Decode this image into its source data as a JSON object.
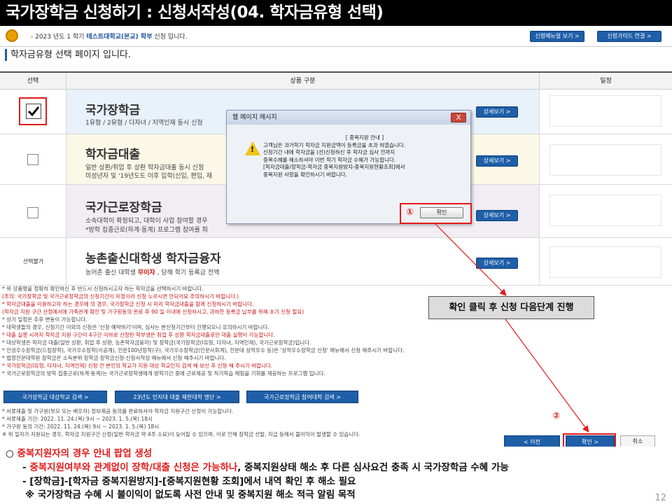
{
  "title": "국가장학금 신청하기 : 신청서작성(04. 학자금유형 선택)",
  "infobar": {
    "prefix": "- 2023 년도 1 학기",
    "school": "테스트대학교(본교) 학부",
    "suffix": "신청 입니다.",
    "btn_menu": "신청메뉴얼 보기 >",
    "btn_guide": "신청가이드 연결 >"
  },
  "section_title": "학자금유형 선택 페이지 입니다.",
  "table": {
    "col_select": "선택",
    "col_product": "상품 구분",
    "col_schedule": "일정",
    "detail_btn": "상세보기 >",
    "rows": [
      {
        "name": "국가장학금",
        "desc1": "1유형 / 2유형 / 다자녀 / 지역인재 동시 신청",
        "desc2": "",
        "checked": true,
        "bg": "#e9f1fa"
      },
      {
        "name": "학자금대출",
        "desc1": "일반 상환/취업 후 상환 학자금대출 동시 신청",
        "desc2": "미성년자 및 '19년도도 이후 입학(신입, 편입, 재",
        "checked": false,
        "bg": "#fbf8e8"
      },
      {
        "name": "국가근로장학금",
        "desc1": "소속대학이 확정되고, 대학이 사업 참여할 경우",
        "desc2": "*방학 집중근로(하계·동계) 프로그램 참여를 희",
        "checked": false,
        "bg": "#f1edf3"
      },
      {
        "name": "농촌출신대학생 학자금융자",
        "desc1": "농어촌 출신 대학생",
        "desc1_red": "무이자",
        "desc1_tail": ", 당해 학기 등록금 전액",
        "checked": false,
        "bg": "#ffffff",
        "disabled_label": "선택불가"
      }
    ]
  },
  "notes": [
    {
      "text": "* 위 상품명을 정확히 확인하신 후 반드시 신청하시고자 하는 학자금을 선택하시기 바랍니다.",
      "red": false
    },
    {
      "text": "(주의: 국가장학금 및 국가근로장학금의 신청기간이 미정이라 신청 누르시면 안되어요 주의하시기 바랍니다.)",
      "red": true
    },
    {
      "text": "* 학자금대출을 이용하고자 하는 경우에 의 경우, 국가장학금 신청 시 미리 학자금대출을 함께 신청하시기 바랍니다.",
      "red": true
    },
    {
      "text": "(학자금 지원 구간 산정에서에 가족관계 확인 및 가구원동의 완료 후 90 일 이내에 신청하시고, 과하한 등록금 납부를 위해 초기 신청 필요)",
      "red": true
    },
    {
      "text": "* 상기 일정은 추후 변동이 가능합니다.",
      "red": false
    },
    {
      "text": "* 대학생들의 경우, 신청기간 이외의 신청은 '신청 예약하기'이며, 심사는 본신청기간부터 진행되오니 유의하시기 바랍니다.",
      "red": false
    },
    {
      "text": "* 대출 실행 시까지 학자금 지원 구간이 4구간 이하로 산정된 학부생은 취업 후 상환 학자금대출로만 대출 실행이 가능합니다.",
      "red": true
    },
    {
      "text": "* 대상학생은 학자금 대출(일반 상환, 취업 후 상환, 농촌학자금융자) 및 장학금(국가장학금(I유형, 다자녀, 지역인재), 국가근로장학금)입니다.",
      "red": false
    },
    {
      "text": "* 인성우수장학금(드림장학), 국가우수장학(이공계), 인문100년장학(구), 국가우수장학금(인문사회계), 전문대 성적우수 등)은 '성적우수장학금 신청' 메뉴에서 신청 해주시기 바랍니다.",
      "red": false
    },
    {
      "text": "* 법정전문대학원 장학금은 소득분위·장학금·장학금신청·신청서작성 메뉴에서 신청 해주시기 바랍니다.",
      "red": false
    },
    {
      "text": "* 국가장학금(I유형, 다자녀, 지역인재) 신청 전 본인의 학교가 지원 대상 학교인지 검색 해 보신 후 신청 해 주시기 바랍니다.",
      "red": true
    },
    {
      "text": "* 국가근로장학금의 방학 집중근로(하계·동계)는 국가근로장학생에게 방학기간 중에 근로제공 및 직기학습 체험을 기회를 제공하는 프로그램 입니다.",
      "red": false
    }
  ],
  "nav_buttons": [
    "국가장학금 대상학교 검색 >",
    "23년도 인지대 대출 제한대학 명단 >",
    "국가근로장학금 참여대학 검색 >"
  ],
  "notes2": [
    "* 서류제출 및 가구원(부모 또는 배우자) 정보제공 동의를 완료하셔야 학자금 지원구간 산정이 가능합니다.",
    "* 서류제출 기간: 2022. 11. 24.(목) 9시 ~ 2023. 1. 5.(목) 18시",
    "* 가구원 동의 기간: 2022. 11. 24.(목) 9시 ~ 2023. 1. 5.(목) 18시",
    "※ 위 일자가 지원되는 경우, 학자금 지원구간 산정(일반 학자금 약 4주 소요)이 늦어질 수 있으며, 이로 인해 장학금 선발, 지급 등에서 불이익이 발생할 수 있습니다."
  ],
  "footer_buttons": {
    "prev": "< 이전",
    "next": "확인 >",
    "cancel": "취소"
  },
  "dialog": {
    "title": "웹 페이지 메시지",
    "close": "X",
    "lines": [
      "[ 중복지원 안내 ]",
      "고객님은 과거학기 학자금 지원금액이 등록금을 초과 하였습니다.",
      "신청기간 내에 학자금을 (선)신청하신 후 학자금 심사 전까지",
      "중복수혜를 해소하셔야 이번 학기 학자금 수혜가 가능합니다.",
      "[학자금대출/장학금-학자금 중복지원방지-중복지원현황조회]에서",
      "중복지원 사항을 확인하시기 바랍니다."
    ],
    "ok": "확인"
  },
  "markers": {
    "one": "①",
    "two": "②"
  },
  "callout": "확인 클릭 후 신청 다음단계 진행",
  "bottom": {
    "line1_prefix": "○ ",
    "line1": "중복지원자의 경우 안내 팝업 생성",
    "line2_dash": "- ",
    "line2_red": "중복지원여부와 관계없이 장학/대출 신청은 가능하나",
    "line2_tail": ", 중복지원상태 해소 후 다른 심사요건 충족 시 국가장학금 수혜 가능",
    "line3": "- [장학금]-[학자금 중복지원방지]-[중복지원현황 조회]에서 내역 확인 후 해소 필요",
    "line4": "※ 국가장학금 수혜 시 불이익이 없도록 사전 안내 및 중복지원 해소 적극 알림 목적"
  },
  "page_number": "12",
  "colors": {
    "accent": "#1e5fa8",
    "alert": "#e21b1b"
  }
}
